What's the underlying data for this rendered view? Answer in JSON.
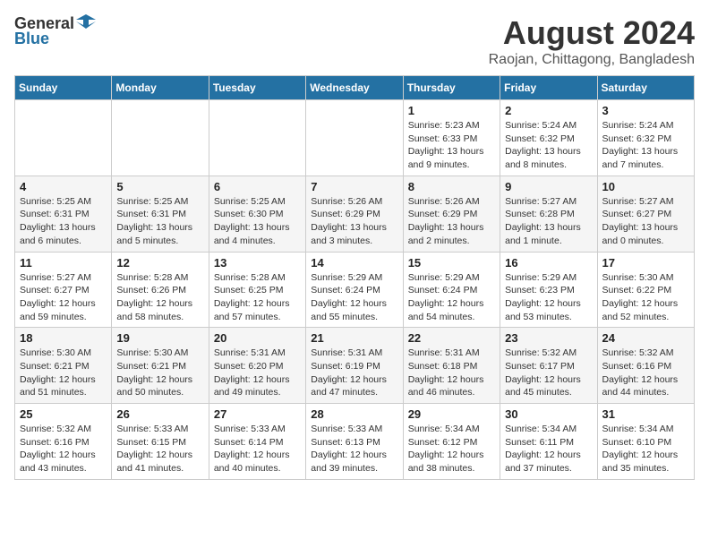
{
  "logo": {
    "general": "General",
    "blue": "Blue"
  },
  "title": {
    "month_year": "August 2024",
    "location": "Raojan, Chittagong, Bangladesh"
  },
  "weekdays": [
    "Sunday",
    "Monday",
    "Tuesday",
    "Wednesday",
    "Thursday",
    "Friday",
    "Saturday"
  ],
  "weeks": [
    [
      {
        "day": "",
        "info": ""
      },
      {
        "day": "",
        "info": ""
      },
      {
        "day": "",
        "info": ""
      },
      {
        "day": "",
        "info": ""
      },
      {
        "day": "1",
        "info": "Sunrise: 5:23 AM\nSunset: 6:33 PM\nDaylight: 13 hours\nand 9 minutes."
      },
      {
        "day": "2",
        "info": "Sunrise: 5:24 AM\nSunset: 6:32 PM\nDaylight: 13 hours\nand 8 minutes."
      },
      {
        "day": "3",
        "info": "Sunrise: 5:24 AM\nSunset: 6:32 PM\nDaylight: 13 hours\nand 7 minutes."
      }
    ],
    [
      {
        "day": "4",
        "info": "Sunrise: 5:25 AM\nSunset: 6:31 PM\nDaylight: 13 hours\nand 6 minutes."
      },
      {
        "day": "5",
        "info": "Sunrise: 5:25 AM\nSunset: 6:31 PM\nDaylight: 13 hours\nand 5 minutes."
      },
      {
        "day": "6",
        "info": "Sunrise: 5:25 AM\nSunset: 6:30 PM\nDaylight: 13 hours\nand 4 minutes."
      },
      {
        "day": "7",
        "info": "Sunrise: 5:26 AM\nSunset: 6:29 PM\nDaylight: 13 hours\nand 3 minutes."
      },
      {
        "day": "8",
        "info": "Sunrise: 5:26 AM\nSunset: 6:29 PM\nDaylight: 13 hours\nand 2 minutes."
      },
      {
        "day": "9",
        "info": "Sunrise: 5:27 AM\nSunset: 6:28 PM\nDaylight: 13 hours\nand 1 minute."
      },
      {
        "day": "10",
        "info": "Sunrise: 5:27 AM\nSunset: 6:27 PM\nDaylight: 13 hours\nand 0 minutes."
      }
    ],
    [
      {
        "day": "11",
        "info": "Sunrise: 5:27 AM\nSunset: 6:27 PM\nDaylight: 12 hours\nand 59 minutes."
      },
      {
        "day": "12",
        "info": "Sunrise: 5:28 AM\nSunset: 6:26 PM\nDaylight: 12 hours\nand 58 minutes."
      },
      {
        "day": "13",
        "info": "Sunrise: 5:28 AM\nSunset: 6:25 PM\nDaylight: 12 hours\nand 57 minutes."
      },
      {
        "day": "14",
        "info": "Sunrise: 5:29 AM\nSunset: 6:24 PM\nDaylight: 12 hours\nand 55 minutes."
      },
      {
        "day": "15",
        "info": "Sunrise: 5:29 AM\nSunset: 6:24 PM\nDaylight: 12 hours\nand 54 minutes."
      },
      {
        "day": "16",
        "info": "Sunrise: 5:29 AM\nSunset: 6:23 PM\nDaylight: 12 hours\nand 53 minutes."
      },
      {
        "day": "17",
        "info": "Sunrise: 5:30 AM\nSunset: 6:22 PM\nDaylight: 12 hours\nand 52 minutes."
      }
    ],
    [
      {
        "day": "18",
        "info": "Sunrise: 5:30 AM\nSunset: 6:21 PM\nDaylight: 12 hours\nand 51 minutes."
      },
      {
        "day": "19",
        "info": "Sunrise: 5:30 AM\nSunset: 6:21 PM\nDaylight: 12 hours\nand 50 minutes."
      },
      {
        "day": "20",
        "info": "Sunrise: 5:31 AM\nSunset: 6:20 PM\nDaylight: 12 hours\nand 49 minutes."
      },
      {
        "day": "21",
        "info": "Sunrise: 5:31 AM\nSunset: 6:19 PM\nDaylight: 12 hours\nand 47 minutes."
      },
      {
        "day": "22",
        "info": "Sunrise: 5:31 AM\nSunset: 6:18 PM\nDaylight: 12 hours\nand 46 minutes."
      },
      {
        "day": "23",
        "info": "Sunrise: 5:32 AM\nSunset: 6:17 PM\nDaylight: 12 hours\nand 45 minutes."
      },
      {
        "day": "24",
        "info": "Sunrise: 5:32 AM\nSunset: 6:16 PM\nDaylight: 12 hours\nand 44 minutes."
      }
    ],
    [
      {
        "day": "25",
        "info": "Sunrise: 5:32 AM\nSunset: 6:16 PM\nDaylight: 12 hours\nand 43 minutes."
      },
      {
        "day": "26",
        "info": "Sunrise: 5:33 AM\nSunset: 6:15 PM\nDaylight: 12 hours\nand 41 minutes."
      },
      {
        "day": "27",
        "info": "Sunrise: 5:33 AM\nSunset: 6:14 PM\nDaylight: 12 hours\nand 40 minutes."
      },
      {
        "day": "28",
        "info": "Sunrise: 5:33 AM\nSunset: 6:13 PM\nDaylight: 12 hours\nand 39 minutes."
      },
      {
        "day": "29",
        "info": "Sunrise: 5:34 AM\nSunset: 6:12 PM\nDaylight: 12 hours\nand 38 minutes."
      },
      {
        "day": "30",
        "info": "Sunrise: 5:34 AM\nSunset: 6:11 PM\nDaylight: 12 hours\nand 37 minutes."
      },
      {
        "day": "31",
        "info": "Sunrise: 5:34 AM\nSunset: 6:10 PM\nDaylight: 12 hours\nand 35 minutes."
      }
    ]
  ]
}
